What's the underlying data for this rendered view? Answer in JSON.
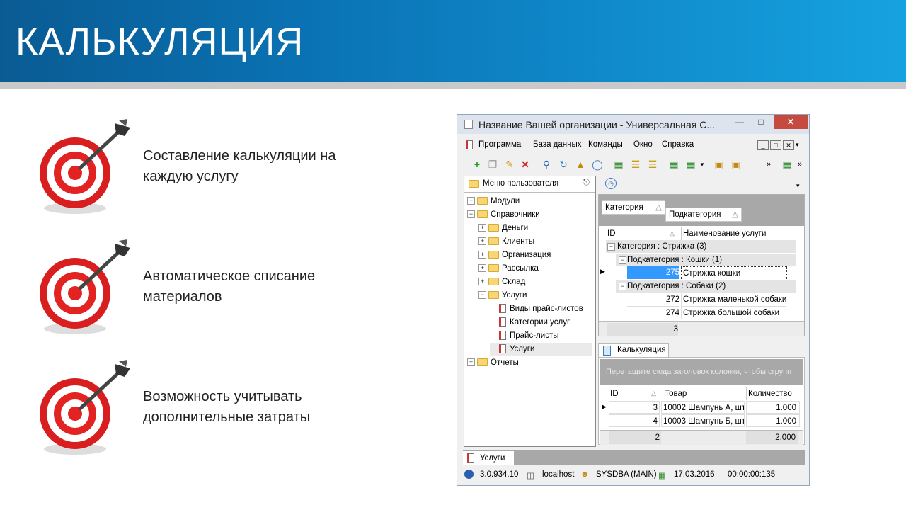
{
  "slide": {
    "title": "КАЛЬКУЛЯЦИЯ",
    "bullets": [
      {
        "line1": "Составление калькуляции на",
        "line2": "каждую услугу"
      },
      {
        "line1": "Автоматическое списание",
        "line2": "материалов"
      },
      {
        "line1": "Возможность учитывать",
        "line2": "дополнительные затраты"
      }
    ]
  },
  "app": {
    "title": "Название Вашей организации - Универсальная С...",
    "menu": [
      "Программа",
      "База данных",
      "Команды",
      "Окно",
      "Справка"
    ],
    "left_panel": {
      "title": "Меню пользователя",
      "tree": [
        {
          "label": "Модули",
          "level": 0,
          "expander": "+",
          "icon": "folder-icon"
        },
        {
          "label": "Справочники",
          "level": 0,
          "expander": "−",
          "icon": "folder-open-icon"
        },
        {
          "label": "Деньги",
          "level": 1,
          "expander": "+",
          "icon": "folder-icon"
        },
        {
          "label": "Клиенты",
          "level": 1,
          "expander": "+",
          "icon": "folder-icon"
        },
        {
          "label": "Организация",
          "level": 1,
          "expander": "+",
          "icon": "folder-icon"
        },
        {
          "label": "Рассылка",
          "level": 1,
          "expander": "+",
          "icon": "folder-icon"
        },
        {
          "label": "Склад",
          "level": 1,
          "expander": "+",
          "icon": "folder-icon"
        },
        {
          "label": "Услуги",
          "level": 1,
          "expander": "−",
          "icon": "folder-open-icon"
        },
        {
          "label": "Виды прайс-листов",
          "level": 2,
          "expander": "",
          "icon": "document-icon"
        },
        {
          "label": "Категории услуг",
          "level": 2,
          "expander": "",
          "icon": "document-icon"
        },
        {
          "label": "Прайс-листы",
          "level": 2,
          "expander": "",
          "icon": "document-icon"
        },
        {
          "label": "Услуги",
          "level": 2,
          "expander": "",
          "icon": "document-icon",
          "selected": true
        },
        {
          "label": "Отчеты",
          "level": 0,
          "expander": "+",
          "icon": "folder-icon"
        }
      ]
    },
    "services_grid": {
      "group_chips": [
        "Категория",
        "Подкатегория"
      ],
      "columns": [
        "ID",
        "Наименование услуги"
      ],
      "group_level1": "Категория : Стрижка (3)",
      "subgroup1": "Подкатегория : Кошки (1)",
      "row1": {
        "id": "275",
        "name": "Стрижка кошки"
      },
      "subgroup2": "Подкатегория : Собаки (2)",
      "row2": {
        "id": "272",
        "name": "Стрижка маленькой собаки"
      },
      "row3": {
        "id": "274",
        "name": "Стрижка большой собаки"
      },
      "footer_count": "3"
    },
    "calc": {
      "tab": "Калькуляция",
      "group_hint": "Перетащите сюда заголовок колонки, чтобы сгрупп",
      "columns": [
        "ID",
        "Товар",
        "Количество"
      ],
      "rows": [
        {
          "id": "3",
          "item": "10002 Шампунь А, шт",
          "qty": "1.000"
        },
        {
          "id": "4",
          "item": "10003 Шампунь Б, шт",
          "qty": "1.000"
        }
      ],
      "footer_count": "2",
      "footer_total": "2.000"
    },
    "bottom_tab": "Услуги",
    "status": {
      "version": "3.0.934.10",
      "server": "localhost",
      "user": "SYSDBA (MAIN)",
      "date": "17.03.2016",
      "time": "00:00:00:135"
    }
  }
}
